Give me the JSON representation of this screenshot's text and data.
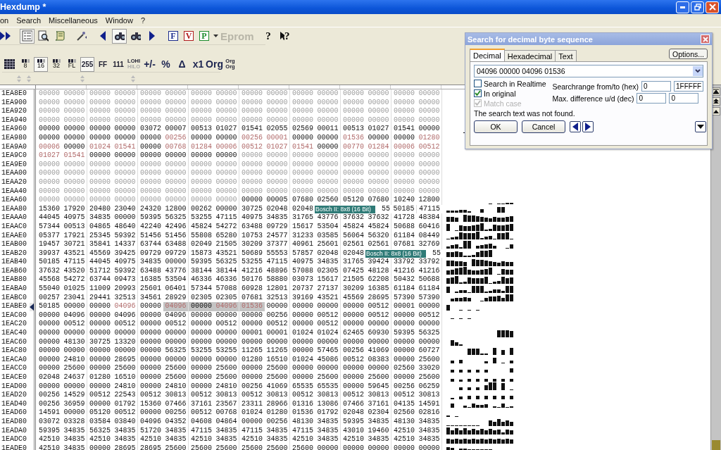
{
  "window": {
    "title": "Hexdump *"
  },
  "menu": [
    "on",
    "Search",
    "Miscellaneous",
    "Window",
    "?"
  ],
  "toolbar": {
    "letter_buttons": [
      {
        "text": "F",
        "color": "#1c2c8c"
      },
      {
        "text": "V",
        "color": "#b01c1c"
      },
      {
        "text": "P",
        "color": "#1c8c2c"
      }
    ],
    "eprom": "Eprom",
    "help": "?",
    "pointer_help": "?"
  },
  "format_toolbar": [
    {
      "kind": "width",
      "text": "8",
      "selected": false
    },
    {
      "kind": "width",
      "text": "16",
      "selected": true
    },
    {
      "kind": "width",
      "text": "32",
      "selected": false
    },
    {
      "kind": "width",
      "text": "FL",
      "selected": false
    },
    {
      "kind": "format",
      "text": "255",
      "selected": true
    },
    {
      "kind": "format",
      "text": "FF",
      "selected": false
    },
    {
      "kind": "format",
      "text": "111",
      "selected": false
    },
    {
      "kind": "order",
      "text": "LOHI",
      "sub": "HILO",
      "selected": false
    },
    {
      "kind": "op",
      "text": "+/-",
      "selected": false
    },
    {
      "kind": "op",
      "text": "%",
      "selected": false
    },
    {
      "kind": "op",
      "text": "Δ",
      "selected": false
    },
    {
      "kind": "op",
      "text": "x1",
      "selected": false
    },
    {
      "kind": "op",
      "text": "Org",
      "selected": false
    },
    {
      "kind": "order",
      "text": "Org",
      "sub": "Org",
      "selected": false
    }
  ],
  "hexdump": {
    "rows": [
      {
        "address": "1EA8E0",
        "current": false,
        "kind": "dim",
        "values": [
          "00000",
          "00000",
          "00000",
          "00000",
          "00000",
          "00000",
          "00000",
          "00000",
          "00000",
          "00000",
          "00000",
          "00000",
          "00000",
          "00000",
          "00000",
          "00000"
        ]
      },
      {
        "address": "1EA900",
        "current": false,
        "kind": "dim",
        "values": [
          "00000",
          "00000",
          "00000",
          "00000",
          "00000",
          "00000",
          "00000",
          "00000",
          "00000",
          "00000",
          "00000",
          "00000",
          "00000",
          "00000",
          "00000",
          "00000"
        ]
      },
      {
        "address": "1EA920",
        "current": false,
        "kind": "dim",
        "values": [
          "00000",
          "00000",
          "00000",
          "00000",
          "00000",
          "00000",
          "00000",
          "00000",
          "00000",
          "00000",
          "00000",
          "00000",
          "00000",
          "00000",
          "00000",
          "00000"
        ]
      },
      {
        "address": "1EA940",
        "current": false,
        "kind": "dim",
        "values": [
          "00000",
          "00000",
          "00000",
          "00000",
          "00000",
          "00000",
          "00000",
          "00000",
          "00000",
          "00000",
          "00000",
          "00000",
          "00000",
          "00000",
          "00000",
          "00000"
        ]
      },
      {
        "address": "1EA960",
        "current": false,
        "kind": "plain",
        "values": [
          "00000",
          "00000",
          "00000",
          "00000",
          "03072",
          "00007",
          "00513",
          "01027",
          "01541",
          "02055",
          "02569",
          "00011",
          "00513",
          "01027",
          "01541",
          "00000"
        ]
      },
      {
        "address": "1EA980",
        "current": false,
        "cells": [
          {
            "value": "00000",
            "kind": "plain"
          },
          {
            "value": "00000",
            "kind": "plain"
          },
          {
            "value": "00000",
            "kind": "plain"
          },
          {
            "value": "00000",
            "kind": "plain"
          },
          {
            "value": "00000",
            "kind": "plain"
          },
          {
            "value": "00256",
            "kind": "changed"
          },
          {
            "value": "00000",
            "kind": "plain"
          },
          {
            "value": "00000",
            "kind": "plain"
          },
          {
            "value": "00256",
            "kind": "changed"
          },
          {
            "value": "00001",
            "kind": "changed"
          },
          {
            "value": "00000",
            "kind": "plain"
          },
          {
            "value": "00000",
            "kind": "plain"
          },
          {
            "value": "01536",
            "kind": "changed"
          },
          {
            "value": "00000",
            "kind": "plain"
          },
          {
            "value": "00000",
            "kind": "plain"
          },
          {
            "value": "01280",
            "kind": "changed"
          }
        ]
      },
      {
        "address": "1EA9A0",
        "current": false,
        "cells": [
          {
            "value": "00006",
            "kind": "changed"
          },
          {
            "value": "00000",
            "kind": "plain"
          },
          {
            "value": "01024",
            "kind": "changed"
          },
          {
            "value": "01541",
            "kind": "changed"
          },
          {
            "value": "00000",
            "kind": "plain"
          },
          {
            "value": "00768",
            "kind": "changed"
          },
          {
            "value": "01284",
            "kind": "changed"
          },
          {
            "value": "00006",
            "kind": "changed"
          },
          {
            "value": "00512",
            "kind": "changed"
          },
          {
            "value": "01027",
            "kind": "changed"
          },
          {
            "value": "01541",
            "kind": "changed"
          },
          {
            "value": "00000",
            "kind": "plain"
          },
          {
            "value": "00770",
            "kind": "changed"
          },
          {
            "value": "01284",
            "kind": "changed"
          },
          {
            "value": "00006",
            "kind": "changed"
          },
          {
            "value": "00512",
            "kind": "changed"
          }
        ]
      },
      {
        "address": "1EA9C0",
        "current": false,
        "cells": [
          {
            "value": "01027",
            "kind": "changed"
          },
          {
            "value": "01541",
            "kind": "changed"
          },
          {
            "value": "00000",
            "kind": "plain"
          },
          {
            "value": "00000",
            "kind": "plain"
          },
          {
            "value": "00000",
            "kind": "plain"
          },
          {
            "value": "00000",
            "kind": "plain"
          },
          {
            "value": "00000",
            "kind": "plain"
          },
          {
            "value": "00000",
            "kind": "plain"
          },
          {
            "value": "00000",
            "kind": "dim"
          },
          {
            "value": "00000",
            "kind": "dim"
          },
          {
            "value": "00000",
            "kind": "dim"
          },
          {
            "value": "00000",
            "kind": "dim"
          },
          {
            "value": "00000",
            "kind": "dim"
          },
          {
            "value": "00000",
            "kind": "dim"
          },
          {
            "value": "00000",
            "kind": "dim"
          },
          {
            "value": "00000",
            "kind": "dim"
          }
        ]
      },
      {
        "address": "1EA9E0",
        "current": false,
        "kind": "dim",
        "values": [
          "00000",
          "00000",
          "00000",
          "00000",
          "00000",
          "00000",
          "00000",
          "00000",
          "00000",
          "00000",
          "00000",
          "00000",
          "00000",
          "00000",
          "00000",
          "00000"
        ]
      },
      {
        "address": "1EAA00",
        "current": false,
        "kind": "dim",
        "values": [
          "00000",
          "00000",
          "00000",
          "00000",
          "00000",
          "00000",
          "00000",
          "00000",
          "00000",
          "00000",
          "00000",
          "00000",
          "00000",
          "00000",
          "00000",
          "00000"
        ]
      },
      {
        "address": "1EAA20",
        "current": false,
        "kind": "dim",
        "values": [
          "00000",
          "00000",
          "00000",
          "00000",
          "00000",
          "00000",
          "00000",
          "00000",
          "00000",
          "00000",
          "00000",
          "00000",
          "00000",
          "00000",
          "00000",
          "00000"
        ]
      },
      {
        "address": "1EAA40",
        "current": false,
        "kind": "dim",
        "values": [
          "00000",
          "00000",
          "00000",
          "00000",
          "00000",
          "00000",
          "00000",
          "00000",
          "00000",
          "00000",
          "00000",
          "00000",
          "00000",
          "00000",
          "00000",
          "00000"
        ]
      },
      {
        "address": "1EAA60",
        "current": false,
        "cells": [
          {
            "value": "00000",
            "kind": "dim"
          },
          {
            "value": "00000",
            "kind": "dim"
          },
          {
            "value": "00000",
            "kind": "dim"
          },
          {
            "value": "00000",
            "kind": "dim"
          },
          {
            "value": "00000",
            "kind": "dim"
          },
          {
            "value": "00000",
            "kind": "dim"
          },
          {
            "value": "00000",
            "kind": "dim"
          },
          {
            "value": "00000",
            "kind": "dim"
          },
          {
            "value": "00000",
            "kind": "plain"
          },
          {
            "value": "00005",
            "kind": "plain"
          },
          {
            "value": "07680",
            "kind": "plain"
          },
          {
            "value": "02560",
            "kind": "plain"
          },
          {
            "value": "05120",
            "kind": "plain"
          },
          {
            "value": "07680",
            "kind": "plain"
          },
          {
            "value": "10240",
            "kind": "plain"
          },
          {
            "value": "12800",
            "kind": "plain"
          }
        ]
      },
      {
        "address": "1EAA80",
        "current": false,
        "kind": "plain",
        "values": [
          "15360",
          "17920",
          "20480",
          "23040",
          "24320",
          "12800",
          "00262",
          "00000",
          "30725",
          "02048",
          "02048"
        ],
        "map_label": "Bosch II: 8x8 (16 Bit)",
        "after": [
          "55",
          "50185",
          "47115"
        ]
      },
      {
        "address": "1EAAA0",
        "current": false,
        "kind": "plain",
        "values": [
          "44045",
          "40975",
          "34835",
          "00000",
          "59395",
          "56325",
          "53255",
          "47115",
          "40975",
          "34835",
          "31765",
          "43776",
          "37632",
          "37632",
          "41728",
          "48384"
        ]
      },
      {
        "address": "1EAAC0",
        "current": false,
        "kind": "plain",
        "values": [
          "57344",
          "00513",
          "04865",
          "48640",
          "42240",
          "42496",
          "45824",
          "54272",
          "63488",
          "09729",
          "15617",
          "53504",
          "45824",
          "45824",
          "50688",
          "60416"
        ]
      },
      {
        "address": "1EAAE0",
        "current": false,
        "kind": "plain",
        "values": [
          "05377",
          "17921",
          "25345",
          "59392",
          "51456",
          "51456",
          "55808",
          "65280",
          "10753",
          "24577",
          "31233",
          "03585",
          "56064",
          "56320",
          "61184",
          "08449"
        ]
      },
      {
        "address": "1EAB00",
        "current": false,
        "kind": "plain",
        "values": [
          "19457",
          "30721",
          "35841",
          "14337",
          "63744",
          "63488",
          "02049",
          "21505",
          "30209",
          "37377",
          "40961",
          "25601",
          "02561",
          "02561",
          "07681",
          "32769"
        ]
      },
      {
        "address": "1EAB20",
        "current": false,
        "kind": "plain",
        "values": [
          "39937",
          "43521",
          "45569",
          "39425",
          "09729",
          "09729",
          "15873",
          "43521",
          "50689",
          "55553",
          "57857",
          "02048",
          "02048"
        ],
        "map_label": "Bosch II: 8x8 (16 Bit)",
        "after": [
          "55"
        ]
      },
      {
        "address": "1EAB40",
        "current": false,
        "kind": "plain",
        "values": [
          "50185",
          "47115",
          "44045",
          "40975",
          "34835",
          "00000",
          "59395",
          "56325",
          "53255",
          "47115",
          "40975",
          "34835",
          "31765",
          "39424",
          "33792",
          "33792"
        ]
      },
      {
        "address": "1EAB60",
        "current": false,
        "kind": "plain",
        "values": [
          "37632",
          "43520",
          "51712",
          "59392",
          "63488",
          "43776",
          "38144",
          "38144",
          "41216",
          "48896",
          "57088",
          "02305",
          "07425",
          "48128",
          "41216",
          "41216"
        ]
      },
      {
        "address": "1EAB80",
        "current": false,
        "kind": "plain",
        "values": [
          "45568",
          "54272",
          "63744",
          "09473",
          "16385",
          "53504",
          "46336",
          "46336",
          "50176",
          "58880",
          "03073",
          "15617",
          "21505",
          "62208",
          "50432",
          "50688"
        ]
      },
      {
        "address": "1EABA0",
        "current": false,
        "kind": "plain",
        "values": [
          "55040",
          "01025",
          "11009",
          "20993",
          "25601",
          "06401",
          "57344",
          "57088",
          "60928",
          "12801",
          "20737",
          "27137",
          "30209",
          "16385",
          "61184",
          "61184"
        ]
      },
      {
        "address": "1EABC0",
        "current": false,
        "kind": "plain",
        "values": [
          "00257",
          "23041",
          "29441",
          "32513",
          "34561",
          "28929",
          "02305",
          "02305",
          "07681",
          "32513",
          "39169",
          "43521",
          "45569",
          "28695",
          "57390",
          "57390"
        ]
      },
      {
        "address": "1EABE0",
        "current": true,
        "cells": [
          {
            "value": "50185",
            "kind": "plain"
          },
          {
            "value": "00000",
            "kind": "plain"
          },
          {
            "value": "00000",
            "kind": "plain"
          },
          {
            "value": "04096",
            "kind": "changed"
          },
          {
            "value": "00000",
            "kind": "plain"
          },
          {
            "value": "04096",
            "kind": "found-changed"
          },
          {
            "value": "00000",
            "kind": "found"
          },
          {
            "value": "04096",
            "kind": "found-changed"
          },
          {
            "value": "01536",
            "kind": "found-changed"
          },
          {
            "value": "00000",
            "kind": "plain"
          },
          {
            "value": "00000",
            "kind": "plain"
          },
          {
            "value": "00000",
            "kind": "plain"
          },
          {
            "value": "00000",
            "kind": "plain"
          },
          {
            "value": "00512",
            "kind": "plain"
          },
          {
            "value": "00001",
            "kind": "plain"
          },
          {
            "value": "00000",
            "kind": "plain"
          }
        ]
      },
      {
        "address": "1EAC00",
        "current": false,
        "kind": "plain",
        "values": [
          "00000",
          "04096",
          "00000",
          "04096",
          "00000",
          "04096",
          "00000",
          "00000",
          "00000",
          "00256",
          "00000",
          "00512",
          "00000",
          "00512",
          "00000",
          "00512"
        ]
      },
      {
        "address": "1EAC20",
        "current": false,
        "kind": "plain",
        "values": [
          "00000",
          "00512",
          "00000",
          "00512",
          "00000",
          "00512",
          "00000",
          "00512",
          "00000",
          "00512",
          "00000",
          "00512",
          "00000",
          "00000",
          "00000",
          "00000"
        ]
      },
      {
        "address": "1EAC40",
        "current": false,
        "kind": "plain",
        "values": [
          "00000",
          "00000",
          "00000",
          "00000",
          "00000",
          "00000",
          "00000",
          "00000",
          "00001",
          "00001",
          "01024",
          "01024",
          "62465",
          "60930",
          "59395",
          "56325"
        ]
      },
      {
        "address": "1EAC60",
        "current": false,
        "kind": "plain",
        "values": [
          "00000",
          "48130",
          "30725",
          "13320",
          "00000",
          "00000",
          "00000",
          "00000",
          "00000",
          "00000",
          "00000",
          "00000",
          "00000",
          "00000",
          "00000",
          "00000"
        ]
      },
      {
        "address": "1EAC80",
        "current": false,
        "kind": "plain",
        "values": [
          "00000",
          "00000",
          "00000",
          "00000",
          "00000",
          "56325",
          "53255",
          "53255",
          "11265",
          "11265",
          "00000",
          "57465",
          "00256",
          "41069",
          "00000",
          "60727"
        ]
      },
      {
        "address": "1EACA0",
        "current": false,
        "kind": "plain",
        "values": [
          "00000",
          "24810",
          "00000",
          "28695",
          "00000",
          "00000",
          "00000",
          "00000",
          "01280",
          "16510",
          "01024",
          "45086",
          "00512",
          "08383",
          "00000",
          "25600"
        ]
      },
      {
        "address": "1EACC0",
        "current": false,
        "kind": "plain",
        "values": [
          "00000",
          "25600",
          "00000",
          "25600",
          "00000",
          "25600",
          "00000",
          "25600",
          "00000",
          "25600",
          "00000",
          "00000",
          "00000",
          "00000",
          "02560",
          "33020"
        ]
      },
      {
        "address": "1EACE0",
        "current": false,
        "kind": "plain",
        "values": [
          "02048",
          "24637",
          "01280",
          "16510",
          "00000",
          "25600",
          "00000",
          "25600",
          "00000",
          "25600",
          "00000",
          "25600",
          "00000",
          "25600",
          "00000",
          "25600"
        ]
      },
      {
        "address": "1EAD00",
        "current": false,
        "kind": "plain",
        "values": [
          "00000",
          "00000",
          "00000",
          "24810",
          "00000",
          "24810",
          "00000",
          "24810",
          "00256",
          "41069",
          "65535",
          "65535",
          "00000",
          "59645",
          "00256",
          "06259"
        ]
      },
      {
        "address": "1EAD20",
        "current": false,
        "kind": "plain",
        "values": [
          "00256",
          "14529",
          "00512",
          "22543",
          "00512",
          "30813",
          "00512",
          "30813",
          "00512",
          "30813",
          "00512",
          "30813",
          "00512",
          "30813",
          "00512",
          "30813"
        ]
      },
      {
        "address": "1EAD40",
        "current": false,
        "kind": "plain",
        "values": [
          "00256",
          "36959",
          "00000",
          "01792",
          "15360",
          "07466",
          "37161",
          "23567",
          "23311",
          "28966",
          "01316",
          "13086",
          "07466",
          "37161",
          "04135",
          "14591"
        ]
      },
      {
        "address": "1EAD60",
        "current": false,
        "kind": "plain",
        "values": [
          "14591",
          "00000",
          "05120",
          "00512",
          "00000",
          "00256",
          "00512",
          "00768",
          "01024",
          "01280",
          "01536",
          "01792",
          "02048",
          "02304",
          "02560",
          "02816"
        ]
      },
      {
        "address": "1EAD80",
        "current": false,
        "kind": "plain",
        "values": [
          "03072",
          "03328",
          "03584",
          "03840",
          "04096",
          "04352",
          "04608",
          "04864",
          "00000",
          "00256",
          "48130",
          "34835",
          "59395",
          "34835",
          "48130",
          "34835"
        ]
      },
      {
        "address": "1EADA0",
        "current": false,
        "kind": "plain",
        "values": [
          "59395",
          "34835",
          "56325",
          "34835",
          "51720",
          "34835",
          "47115",
          "34835",
          "47115",
          "34835",
          "47115",
          "34835",
          "43010",
          "19460",
          "42510",
          "34835"
        ]
      },
      {
        "address": "1EADC0",
        "current": false,
        "kind": "plain",
        "values": [
          "42510",
          "34835",
          "42510",
          "34835",
          "42510",
          "34835",
          "42510",
          "34835",
          "42510",
          "34835",
          "42510",
          "34835",
          "42510",
          "34835",
          "42510",
          "34835"
        ]
      },
      {
        "address": "1EADE0",
        "current": false,
        "kind": "plain",
        "values": [
          "42510",
          "34835",
          "00000",
          "28695",
          "28695",
          "25600",
          "25600",
          "25600",
          "25600",
          "25600",
          "25600",
          "00000",
          "00000",
          "00000",
          "00000",
          "00000"
        ]
      }
    ]
  },
  "dialog": {
    "title": "Search for decimal byte sequence",
    "tabs": [
      {
        "label": "Decimal",
        "selected": true
      },
      {
        "label": "Hexadecimal",
        "selected": false
      },
      {
        "label": "Text",
        "selected": false
      }
    ],
    "options_button": "Options...",
    "search_value": "04096 00000 04096 01536",
    "checkboxes": [
      {
        "label": "Search in Realtime",
        "checked": false,
        "disabled": false
      },
      {
        "label": "In original",
        "checked": true,
        "disabled": false
      },
      {
        "label": "Match case",
        "checked": true,
        "disabled": true
      }
    ],
    "range": {
      "label": "Searchrange from/to (hex)",
      "from": "0",
      "to": "1FFFFF"
    },
    "difference": {
      "label": "Max. difference u/d (dec)",
      "up": "0",
      "down": "0"
    },
    "message": "The search text was not found.",
    "buttons": [
      "OK",
      "Cancel"
    ]
  }
}
